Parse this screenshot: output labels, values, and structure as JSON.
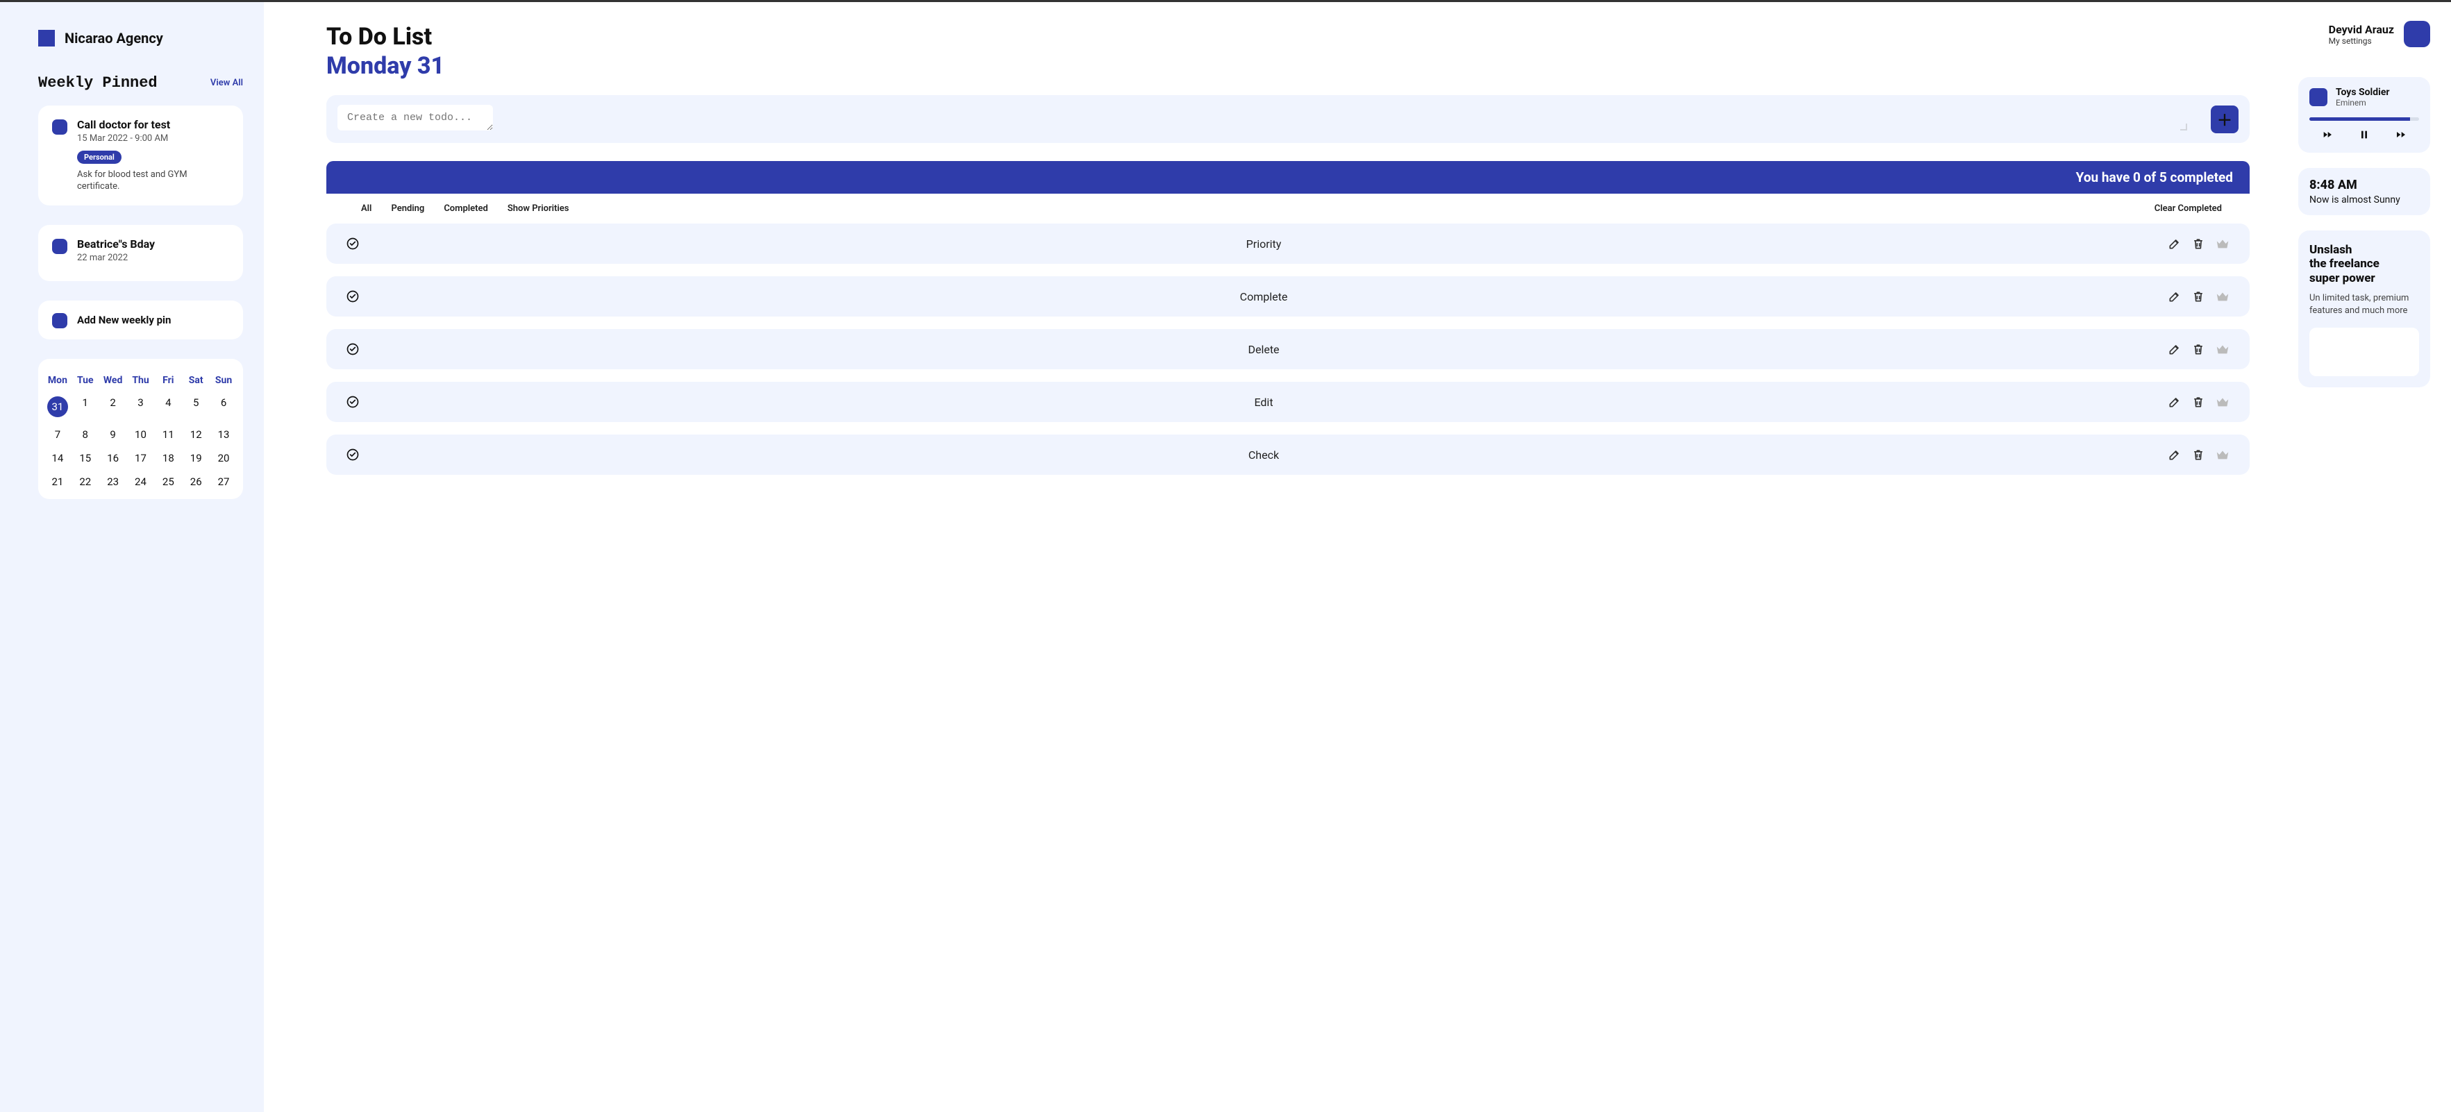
{
  "brand": {
    "name": "Nicarao Agency"
  },
  "weekly": {
    "heading": "Weekly Pinned",
    "view_all": "View All",
    "pins": [
      {
        "title": "Call doctor for test",
        "meta": "15 Mar 2022 - 9:00 AM",
        "tag": "Personal",
        "desc": "Ask for blood test and GYM certificate."
      },
      {
        "title": "Beatrice\"s Bday",
        "meta": "22 mar 2022",
        "tag": "",
        "desc": ""
      }
    ],
    "add_label": "Add New weekly pin"
  },
  "calendar": {
    "days": [
      "Mon",
      "Tue",
      "Wed",
      "Thu",
      "Fri",
      "Sat",
      "Sun"
    ],
    "cells": [
      "31",
      "1",
      "2",
      "3",
      "4",
      "5",
      "6",
      "7",
      "8",
      "9",
      "10",
      "11",
      "12",
      "13",
      "14",
      "15",
      "16",
      "17",
      "18",
      "19",
      "20",
      "21",
      "22",
      "23",
      "24",
      "25",
      "26",
      "27"
    ],
    "selected_index": 0
  },
  "main": {
    "title": "To Do List",
    "date": "Monday 31",
    "input_placeholder": "Create a new todo...",
    "status": "You have 0 of 5 completed",
    "filters": {
      "all": "All",
      "pending": "Pending",
      "completed": "Completed",
      "priorities": "Show Priorities",
      "clear": "Clear Completed"
    },
    "todos": [
      {
        "text": "Priority"
      },
      {
        "text": "Complete"
      },
      {
        "text": "Delete"
      },
      {
        "text": "Edit"
      },
      {
        "text": "Check"
      }
    ]
  },
  "user": {
    "name": "Deyvid Arauz",
    "settings": "My settings"
  },
  "music": {
    "title": "Toys Soldier",
    "artist": "Eminem",
    "progress_pct": 92
  },
  "weather": {
    "time": "8:48 AM",
    "text": "Now is almost Sunny"
  },
  "promo": {
    "title_l1": "Unslash",
    "title_l2": "the freelance",
    "title_l3": "super power",
    "desc": "Un limited task, premium features and much more"
  }
}
